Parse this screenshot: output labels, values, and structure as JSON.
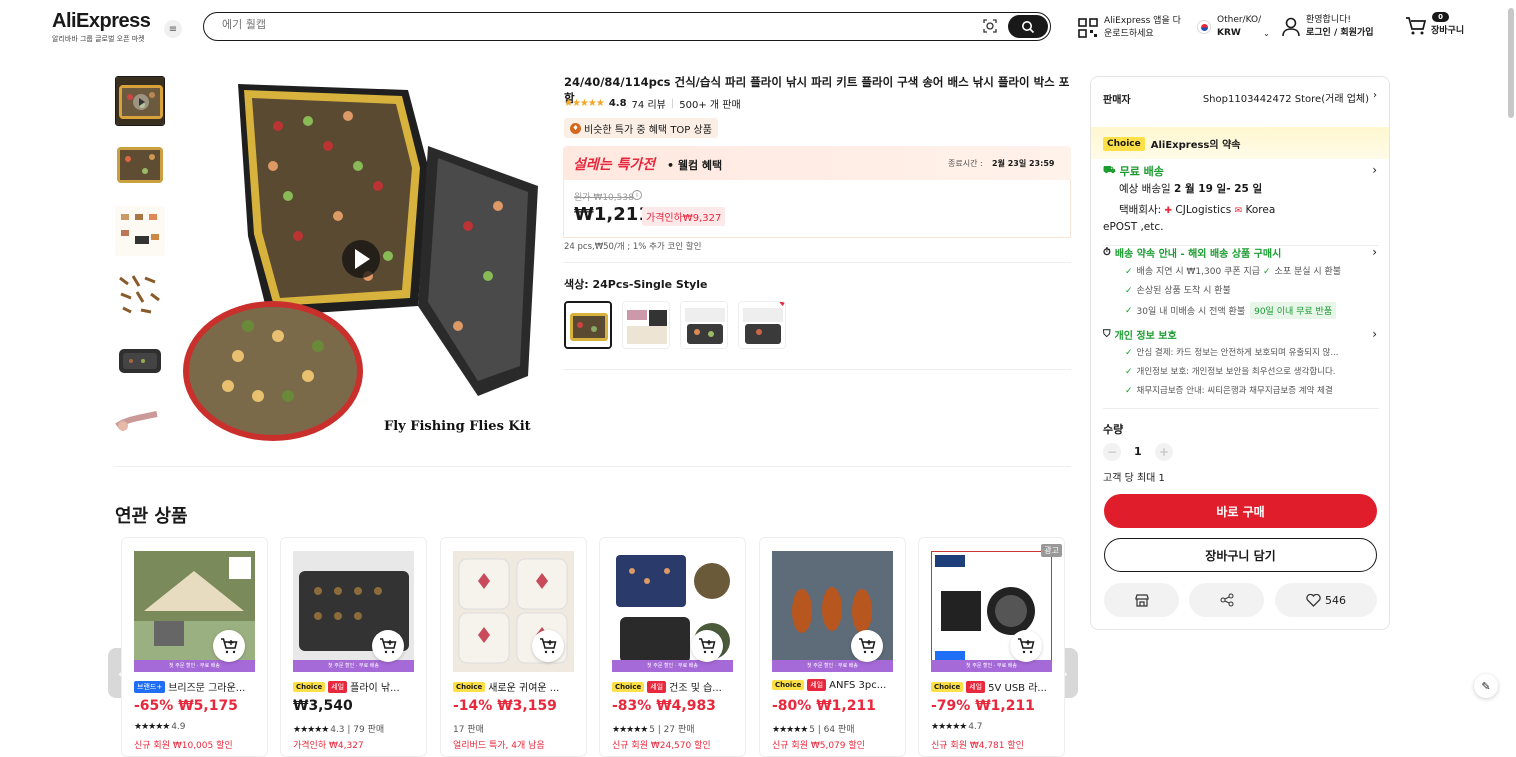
{
  "header": {
    "logo": "AliExpress",
    "logo_sub": "알리바바 그룹 글로벌 오픈 마켓",
    "search_placeholder": "에기 훨캡",
    "app_line1": "AliExpress 앱을 다",
    "app_line2": "운로드하세요",
    "locale_line1": "Other/KO/",
    "locale_line2": "KRW",
    "greet_line1": "환영합니다!",
    "greet_line2": "로그인 / 회원가입",
    "cart_count": "0",
    "cart_label": "장바구니"
  },
  "product": {
    "title": "24/40/84/114pcs 건식/습식 파리 플라이 낚시 파리 키트 플라이 구색 송어 배스 낚시 플라이 박스 포함",
    "rating": "4.8",
    "reviews": "74 리뷰",
    "sold": "500+ 개 판매",
    "top_badge": "비슷한 특가 중 혜택 TOP 상품",
    "promo_logo": "설레는 특가전",
    "promo_sub": "• 웰컴 혜택",
    "end_label": "종료시간 :",
    "end_time": "2월 23일 23:59",
    "orig_label": "원가 ₩10,538",
    "price": "₩1,211",
    "discount": "가격인하₩9,327",
    "unit_note": "24 pcs,₩50/개 ; 1% 추가 코인 할인",
    "color_label": "색상: 24Pcs-Single Style",
    "image_caption": "Fly Fishing Flies Kit"
  },
  "seller": {
    "label": "판매자",
    "store": "Shop1103442472 Store(거래 업체)",
    "choice_badge": "Choice",
    "choice_text": "AliExpress의 약속",
    "free_shipping": "무료 배송",
    "delivery_prefix": "예상 배송일",
    "delivery_range": "2 월 19 일- 25 일",
    "courier_label": "택배회사:",
    "courier1": "CJLogistics",
    "courier2": "Korea",
    "courier3": "ePOST ,etc.",
    "guarantee_title": "배송 약속 안내 - 해외 배송 상품 구매시",
    "g1": "배송 지연 시 ₩1,300 쿠폰 지급",
    "g2": "소포 분실 시 환불",
    "g3": "손상된 상품 도착 시 환불",
    "g4": "30일 내 미배송 시 전액 환불",
    "g4_badge": "90일 이내 무료 반품",
    "privacy_title": "개인 정보 보호",
    "p1": "안심 결제: 카드 정보는 안전하게 보호되며 유출되지 않...",
    "p2": "개인정보 보호: 개인정보 보안을 최우선으로 생각합니다.",
    "p3": "채무지급보증 안내: 씨티은행과 채무지급보증 계약 체결",
    "qty_label": "수량",
    "qty": "1",
    "max_label": "고객 당 최대 1",
    "buy_now": "바로 구매",
    "add_cart": "장바구니 담기",
    "wish_count": "546"
  },
  "related": {
    "title": "연관 상품",
    "items": [
      {
        "badge_type": "brand",
        "badge": "브랜드+",
        "name": "브리즈문 그라운...",
        "price": "-65% ₩5,175",
        "meta": "4.9",
        "promo": "신규 회원 ₩10,005 할인",
        "strip": "첫 주문 할인 · 무료 배송"
      },
      {
        "badge_type": "choice_sale",
        "badge": "Choice",
        "badge2": "세일",
        "name": "플라이 낚...",
        "price": "₩3,540",
        "meta": "4.3 | 79 판매",
        "promo": "가격인하 ₩4,327",
        "strip": "첫 주문 할인 · 무료 배송"
      },
      {
        "badge_type": "choice",
        "badge": "Choice",
        "name": "새로운 귀여운 ...",
        "price": "-14% ₩3,159",
        "meta": "17 판매",
        "promo": "얼리버드 특가, 4개 남음",
        "strip": ""
      },
      {
        "badge_type": "choice_sale",
        "badge": "Choice",
        "badge2": "세일",
        "name": "건조 및 습...",
        "price": "-83% ₩4,983",
        "meta": "5 | 27 판매",
        "promo": "신규 회원 ₩24,570 할인",
        "strip": "첫 주문 할인 · 무료 배송"
      },
      {
        "badge_type": "choice_sale",
        "badge": "Choice",
        "badge2": "세일",
        "name": "ANFS 3pc...",
        "price": "-80% ₩1,211",
        "meta": "5 | 64 판매",
        "promo": "신규 회원 ₩5,079 할인",
        "strip": "첫 주문 할인 · 무료 배송"
      },
      {
        "badge_type": "choice_sale",
        "badge": "Choice",
        "badge2": "세일",
        "name": "5V USB 라...",
        "price": "-79% ₩1,211",
        "meta": "4.7",
        "promo": "신규 회원 ₩4,781 할인",
        "strip": "첫 주문 할인 · 무료 배송",
        "ad": "광고"
      }
    ]
  },
  "colors": {
    "accent": "#e8283c",
    "green": "#1b9c31",
    "choice": "#fde047"
  }
}
